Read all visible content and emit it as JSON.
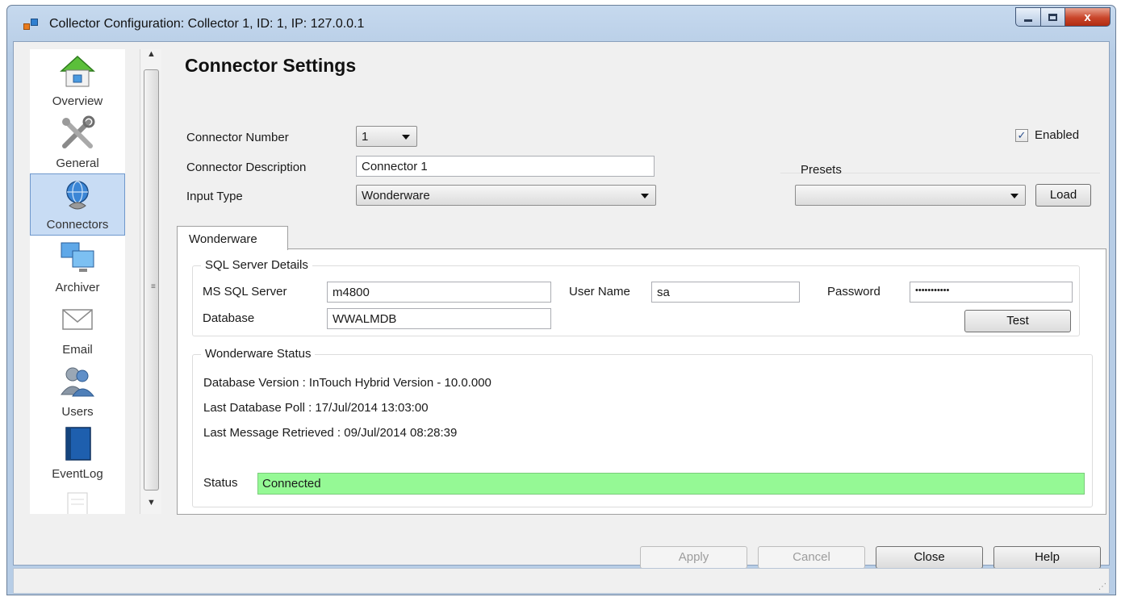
{
  "window": {
    "title": "Collector Configuration: Collector 1, ID: 1, IP: 127.0.0.1",
    "close_glyph": "x"
  },
  "sidebar": {
    "items": [
      {
        "label": "Overview",
        "icon": "house-icon"
      },
      {
        "label": "General",
        "icon": "tools-icon"
      },
      {
        "label": "Connectors",
        "icon": "connector-globe-icon",
        "selected": true
      },
      {
        "label": "Archiver",
        "icon": "computers-icon"
      },
      {
        "label": "Email",
        "icon": "envelope-icon"
      },
      {
        "label": "Users",
        "icon": "users-icon"
      },
      {
        "label": "EventLog",
        "icon": "book-icon"
      }
    ]
  },
  "page": {
    "heading": "Connector Settings"
  },
  "form": {
    "connector_number_label": "Connector Number",
    "connector_number_value": "1",
    "connector_description_label": "Connector Description",
    "connector_description_value": "Connector 1",
    "input_type_label": "Input Type",
    "input_type_value": "Wonderware",
    "enabled_label": "Enabled",
    "enabled_checked": true,
    "check_glyph": "✓",
    "presets_label": "Presets",
    "presets_value": "",
    "load_label": "Load"
  },
  "tab": {
    "label": "Wonderware"
  },
  "sql": {
    "group_title": "SQL Server Details",
    "server_label": "MS SQL Server",
    "server_value": "m4800",
    "user_label": "User Name",
    "user_value": "sa",
    "password_label": "Password",
    "password_value": "•••••••••••",
    "database_label": "Database",
    "database_value": "WWALMDB",
    "test_label": "Test"
  },
  "status": {
    "group_title": "Wonderware Status",
    "db_version": "Database Version : InTouch Hybrid Version - 10.0.000",
    "last_poll": "Last Database Poll : 17/Jul/2014 13:03:00",
    "last_message": "Last Message Retrieved : 09/Jul/2014 08:28:39",
    "status_label": "Status",
    "status_value": "Connected",
    "status_color": "#95f995"
  },
  "footer": {
    "apply_label": "Apply",
    "cancel_label": "Cancel",
    "close_label": "Close",
    "help_label": "Help"
  }
}
